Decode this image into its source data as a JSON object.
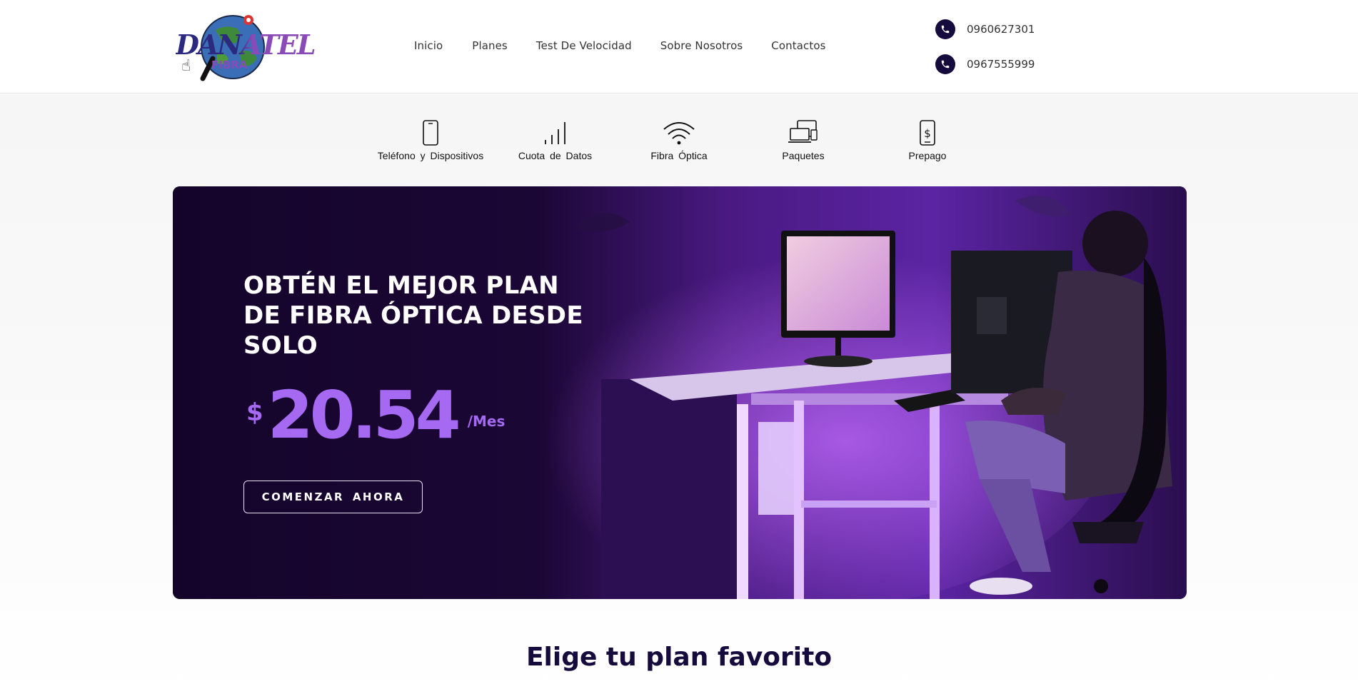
{
  "header": {
    "logo_text": "DANATEL",
    "logo_sub": "FIBRA",
    "nav": [
      {
        "label": "Inicio"
      },
      {
        "label": "Planes"
      },
      {
        "label": "Test De Velocidad"
      },
      {
        "label": "Sobre Nosotros"
      },
      {
        "label": "Contactos"
      }
    ],
    "phones": [
      "0960627301",
      "0967555999"
    ],
    "phone_icon": "phone-icon"
  },
  "categories": [
    {
      "label": "Teléfono y Dispositivos",
      "icon": "smartphone-icon"
    },
    {
      "label": "Cuota de Datos",
      "icon": "signal-bars-icon"
    },
    {
      "label": "Fibra Óptica",
      "icon": "wifi-icon"
    },
    {
      "label": "Paquetes",
      "icon": "devices-icon"
    },
    {
      "label": "Prepago",
      "icon": "prepaid-phone-icon"
    }
  ],
  "hero": {
    "title": "OBTÉN EL MEJOR PLAN DE FIBRA ÓPTICA DESDE SOLO",
    "currency": "$",
    "price": "20.54",
    "period": "/Mes",
    "cta_label": "COMENZAR AHORA",
    "accent_color": "#a569f2",
    "bg_color": "#16052a"
  },
  "plans_section": {
    "title": "Elige tu plan favorito",
    "title_color": "#150b3d"
  }
}
